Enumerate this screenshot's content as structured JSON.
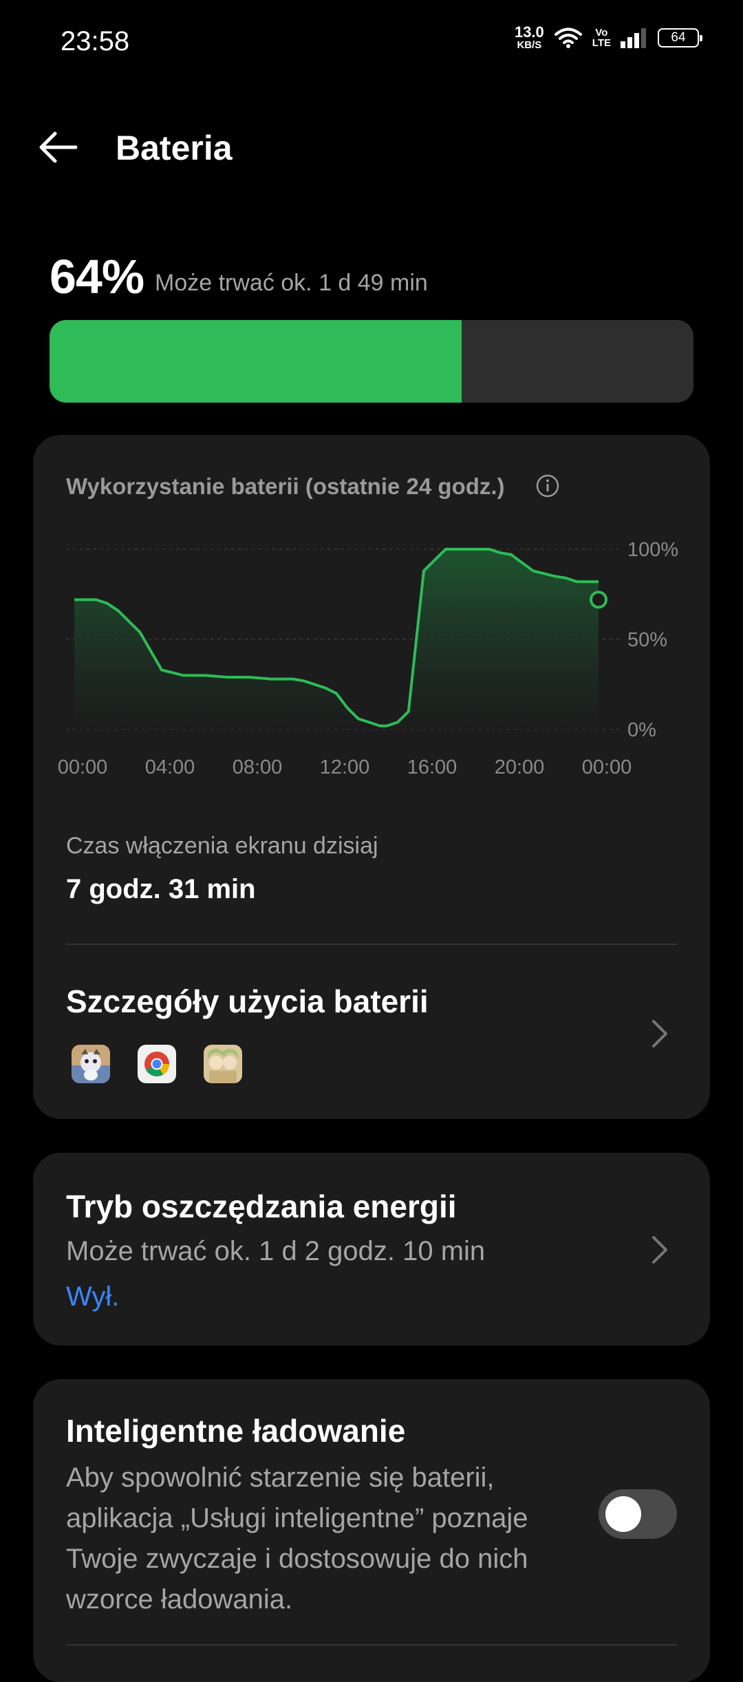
{
  "status_bar": {
    "time": "23:58",
    "net_speed_value": "13.0",
    "net_speed_unit": "KB/S",
    "volte_top": "Vo",
    "volte_bottom": "LTE",
    "battery": "64",
    "icons": [
      "wifi-icon",
      "volte-icon",
      "signal-icon",
      "battery-icon"
    ]
  },
  "header": {
    "title": "Bateria",
    "back_icon": "arrow-left-icon"
  },
  "battery": {
    "percent_label": "64%",
    "level": 64,
    "estimate": "Może trwać ok. 1 d 49 min",
    "fill_color": "#2ebb58"
  },
  "usage_card": {
    "title": "Wykorzystanie baterii (ostatnie 24 godz.)",
    "info_icon": "info-icon",
    "screen_on_label": "Czas włączenia ekranu dzisiaj",
    "screen_on_value": "7 godz. 31 min",
    "details_title": "Szczegóły użycia baterii",
    "app_icons": [
      "game-app-icon",
      "chrome-icon",
      "anime-game-icon"
    ]
  },
  "chart_data": {
    "type": "area",
    "x_ticks": [
      "00:00",
      "04:00",
      "08:00",
      "12:00",
      "16:00",
      "20:00",
      "00:00"
    ],
    "y_ticks": [
      "100%",
      "50%",
      "0%"
    ],
    "ylim": [
      0,
      100
    ],
    "line_color": "#2ebb58",
    "x_hours": [
      0,
      1,
      1.5,
      2,
      2.5,
      3,
      4,
      5,
      6,
      7,
      8,
      9,
      10,
      10.5,
      11,
      11.5,
      12,
      12.5,
      13,
      13.5,
      14,
      14.3,
      14.8,
      15.3,
      16,
      17,
      18,
      19,
      19.5,
      20,
      21,
      22,
      22.5,
      23,
      24
    ],
    "values": [
      72,
      72,
      70,
      66,
      60,
      54,
      33,
      30,
      30,
      29,
      29,
      28,
      28,
      27,
      25,
      23,
      20,
      12,
      6,
      4,
      2,
      2,
      4,
      10,
      88,
      100,
      100,
      100,
      98,
      97,
      88,
      85,
      84,
      82,
      82
    ],
    "end_value": 72
  },
  "power_saver": {
    "title": "Tryb oszczędzania energii",
    "subtitle": "Może trwać ok. 1 d 2 godz. 10 min",
    "state": "Wył."
  },
  "smart_charging": {
    "title": "Inteligentne ładowanie",
    "description": "Aby spowolnić starzenie się baterii,\naplikacja „Usługi inteligentne” poznaje\nTwoje zwyczaje i dostosowuje do nich\nwzorce ładowania.",
    "enabled": false
  }
}
